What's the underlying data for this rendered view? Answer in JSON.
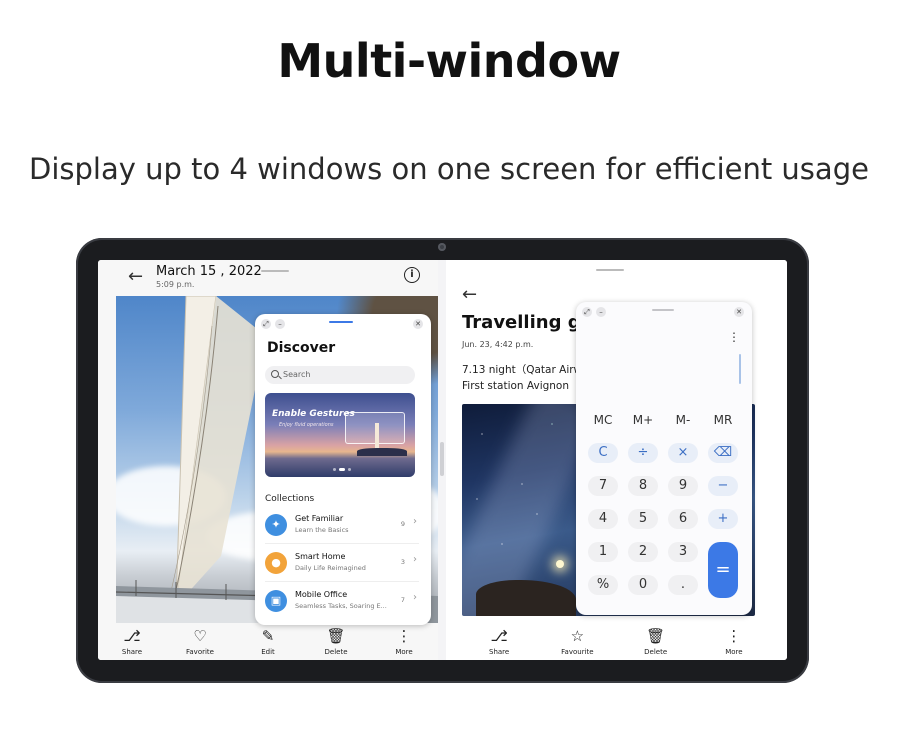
{
  "headline": "Multi-window",
  "subhead": "Display up to 4 windows on one screen for efficient usage",
  "gallery": {
    "date": "March 15 , 2022",
    "time": "5:09 p.m.",
    "info_icon": "i",
    "toolbar": [
      {
        "icon": "share-icon",
        "glyph": "⎇",
        "label": "Share"
      },
      {
        "icon": "heart-icon",
        "glyph": "♡",
        "label": "Favorite"
      },
      {
        "icon": "pen-icon",
        "glyph": "✎",
        "label": "Edit"
      },
      {
        "icon": "trash-icon",
        "glyph": "🗑",
        "label": "Delete"
      },
      {
        "icon": "more-icon",
        "glyph": "⋮",
        "label": "More"
      }
    ]
  },
  "discover": {
    "title": "Discover",
    "search_placeholder": "Search",
    "banner_title": "Enable Gestures",
    "banner_sub": "Enjoy fluid operations",
    "collections_title": "Collections",
    "items": [
      {
        "title": "Get Familiar",
        "sub": "Learn the Basics",
        "count": "9",
        "icon": "compass-icon",
        "glyph": "✦",
        "color": "#3f8fe0"
      },
      {
        "title": "Smart Home",
        "sub": "Daily Life Reimagined",
        "count": "3",
        "icon": "bulb-icon",
        "glyph": "●",
        "color": "#f2a33a"
      },
      {
        "title": "Mobile Office",
        "sub": "Seamless Tasks, Soaring E...",
        "count": "7",
        "icon": "briefcase-icon",
        "glyph": "▣",
        "color": "#3f8fe0"
      }
    ]
  },
  "notes": {
    "title": "Travelling gu",
    "date": "Jun. 23, 4:42 p.m.",
    "line1": "7.13 night（Qatar Airwa",
    "line2": "First station  Avignon",
    "toolbar": [
      {
        "icon": "share-icon",
        "glyph": "⎇",
        "label": "Share"
      },
      {
        "icon": "star-icon",
        "glyph": "☆",
        "label": "Favourite"
      },
      {
        "icon": "trash-icon",
        "glyph": "🗑",
        "label": "Delete"
      },
      {
        "icon": "more-icon",
        "glyph": "⋮",
        "label": "More"
      }
    ]
  },
  "calculator": {
    "memory_keys": [
      "MC",
      "M+",
      "M-",
      "MR"
    ],
    "keys": [
      [
        "C",
        "÷",
        "×",
        "⌫"
      ],
      [
        "7",
        "8",
        "9",
        "−"
      ],
      [
        "4",
        "5",
        "6",
        "+"
      ],
      [
        "1",
        "2",
        "3",
        "="
      ],
      [
        "%",
        "0",
        ".",
        ""
      ]
    ]
  }
}
